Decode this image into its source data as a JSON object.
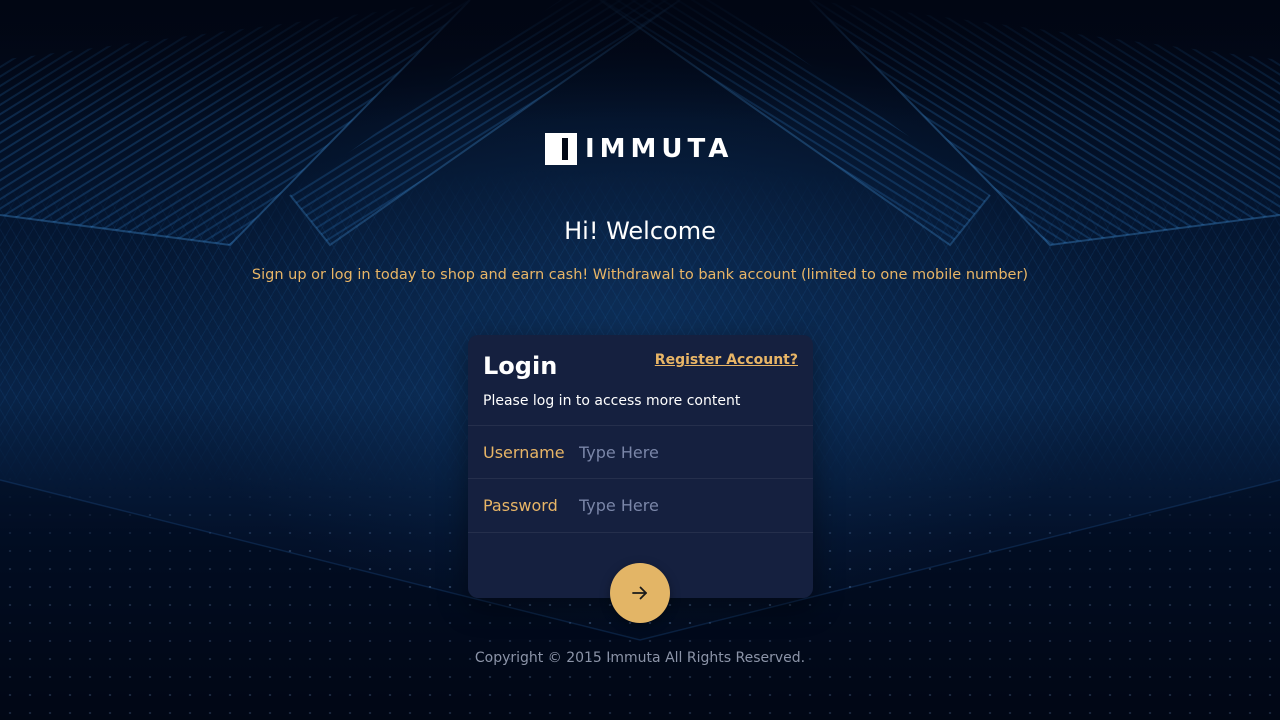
{
  "brand": {
    "logo_text": "IMMUTA"
  },
  "hero": {
    "title": "Hi! Welcome",
    "tagline": "Sign up or log in today to shop and earn cash! Withdrawal to bank account (limited to one mobile number)"
  },
  "login": {
    "title": "Login",
    "register_link": "Register Account?",
    "subtitle": "Please log in to access more content",
    "fields": {
      "username": {
        "label": "Username",
        "placeholder": "Type Here",
        "value": ""
      },
      "password": {
        "label": "Password",
        "placeholder": "Type Here",
        "value": ""
      }
    },
    "submit_icon": "arrow-right-icon"
  },
  "footer": {
    "copyright": "Copyright © 2015 Immuta All Rights Reserved."
  },
  "colors": {
    "accent": "#e3b566",
    "card_bg": "#15203f",
    "page_bg": "#020816",
    "text": "#ffffff",
    "muted": "#8c94a8"
  }
}
